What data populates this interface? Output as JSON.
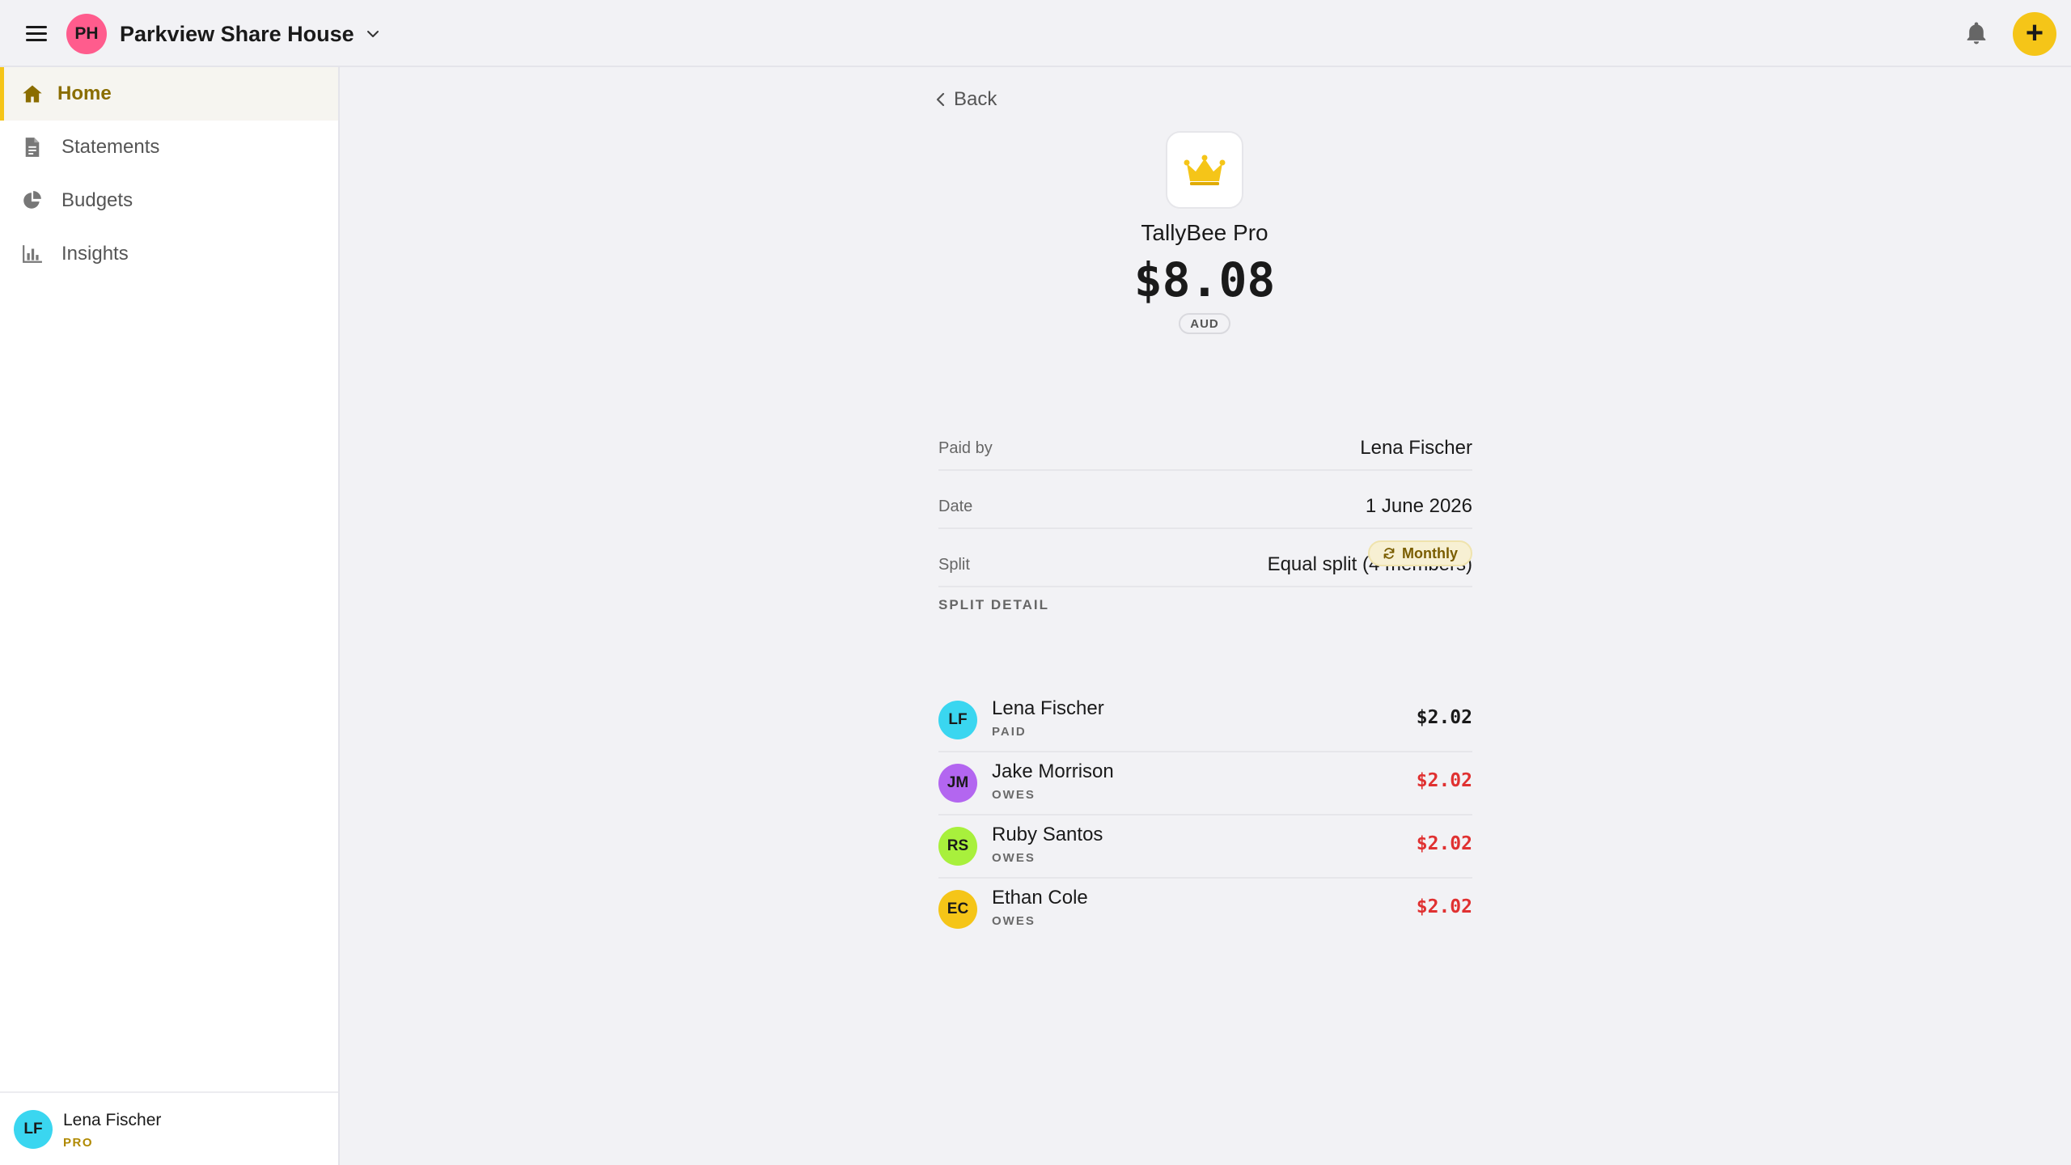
{
  "colors": {
    "accent": "#f5c518",
    "owes": "#e03131",
    "paid": "#1a1a1a"
  },
  "header": {
    "menu_icon": "hamburger-menu-icon",
    "group_initials": "PH",
    "group_avatar_color": "#ff5c8d",
    "group_name": "Parkview Share House",
    "group_chevron_icon": "chevron-down-icon",
    "notifications_icon": "bell-icon",
    "add_icon": "plus-icon"
  },
  "sidebar": {
    "items": [
      {
        "label": "Home",
        "icon": "home-icon",
        "active": true
      },
      {
        "label": "Statements",
        "icon": "document-icon",
        "active": false
      },
      {
        "label": "Budgets",
        "icon": "pie-chart-icon",
        "active": false
      },
      {
        "label": "Insights",
        "icon": "bar-chart-icon",
        "active": false
      }
    ],
    "user": {
      "initials": "LF",
      "avatar_color": "#3ad6f0",
      "name": "Lena Fischer",
      "plan": "PRO"
    }
  },
  "expense": {
    "back_label": "Back",
    "icon": "crown-icon",
    "title": "TallyBee Pro",
    "amount": "$8.08",
    "currency": "AUD",
    "details": [
      {
        "label": "Paid by",
        "value": "Lena Fischer"
      },
      {
        "label": "Date",
        "value": "1 June 2026"
      },
      {
        "label": "Split",
        "value": "Equal split (4 members)"
      }
    ],
    "recurrence": "Monthly",
    "recurrence_icon": "refresh-icon",
    "split_heading": "SPLIT DETAIL",
    "split": [
      {
        "initials": "LF",
        "name": "Lena Fischer",
        "status": "PAID",
        "amount": "$2.02",
        "avatar_color": "#3ad6f0",
        "amount_color": "#1a1a1a"
      },
      {
        "initials": "JM",
        "name": "Jake Morrison",
        "status": "OWES",
        "amount": "$2.02",
        "avatar_color": "#b366f0",
        "amount_color": "#e03131"
      },
      {
        "initials": "RS",
        "name": "Ruby Santos",
        "status": "OWES",
        "amount": "$2.02",
        "avatar_color": "#a8f03c",
        "amount_color": "#e03131"
      },
      {
        "initials": "EC",
        "name": "Ethan Cole",
        "status": "OWES",
        "amount": "$2.02",
        "avatar_color": "#f5c518",
        "amount_color": "#e03131"
      }
    ]
  }
}
